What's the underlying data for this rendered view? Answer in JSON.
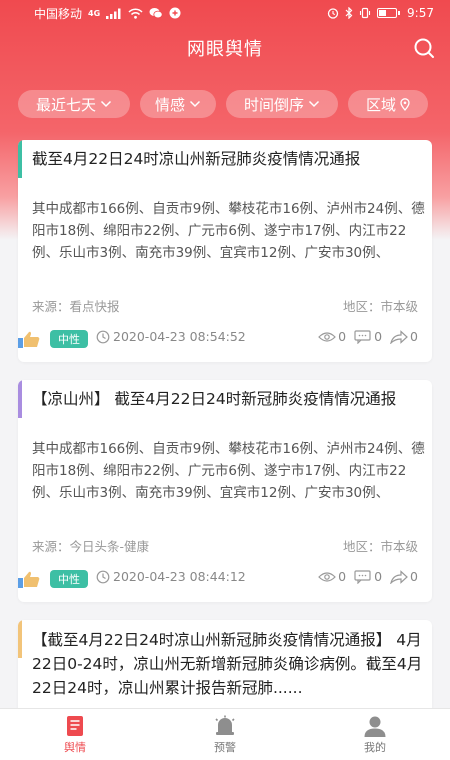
{
  "status": {
    "carrier": "中国移动",
    "network": "4G",
    "time": "9:57",
    "battery_level": 0.45
  },
  "header": {
    "title": "网眼舆情"
  },
  "filters": [
    {
      "label": "最近七天",
      "icon": "chevron-down-icon"
    },
    {
      "label": "情感",
      "icon": "chevron-down-icon"
    },
    {
      "label": "时间倒序",
      "icon": "chevron-down-icon"
    },
    {
      "label": "区域",
      "icon": "location-pin-icon"
    }
  ],
  "articles": [
    {
      "accent_color": "#3dbfa4",
      "title": "截至4月22日24时凉山州新冠肺炎疫情情况通报",
      "body": "其中成都市166例、自贡市9例、攀枝花市16例、泸州市24例、德阳市18例、绵阳市22例、广元市6例、遂宁市17例、内江市22例、乐山市3例、南充市39例、宜宾市12例、广安市30例、",
      "source": "来源：看点快报",
      "region": "地区：市本级",
      "sentiment": "中性",
      "datetime": "2020-04-23 08:54:52",
      "views": "0",
      "comments": "0",
      "shares": "0"
    },
    {
      "accent_color": "#a98de0",
      "title": "【凉山州】 截至4月22日24时新冠肺炎疫情情况通报",
      "body": "其中成都市166例、自贡市9例、攀枝花市16例、泸州市24例、德阳市18例、绵阳市22例、广元市6例、遂宁市17例、内江市22例、乐山市3例、南充市39例、宜宾市12例、广安市30例、",
      "source": "来源：今日头条-健康",
      "region": "地区：市本级",
      "sentiment": "中性",
      "datetime": "2020-04-23 08:44:12",
      "views": "0",
      "comments": "0",
      "shares": "0"
    },
    {
      "accent_color": "#f2c47a",
      "title": "【截至4月22日24时凉山州新冠肺炎疫情情况通报】 4月22日0-24时，凉山州无新增新冠肺炎确诊病例。截至4月22日24时，凉山州累计报告新冠肺......"
    }
  ],
  "tabs": [
    {
      "label": "舆情",
      "icon": "news-icon",
      "active": true
    },
    {
      "label": "预警",
      "icon": "bell-icon",
      "active": false
    },
    {
      "label": "我的",
      "icon": "user-icon",
      "active": false
    }
  ],
  "colors": {
    "brand": "#ee4a4f",
    "neutral_tag": "#3dbfa4"
  }
}
